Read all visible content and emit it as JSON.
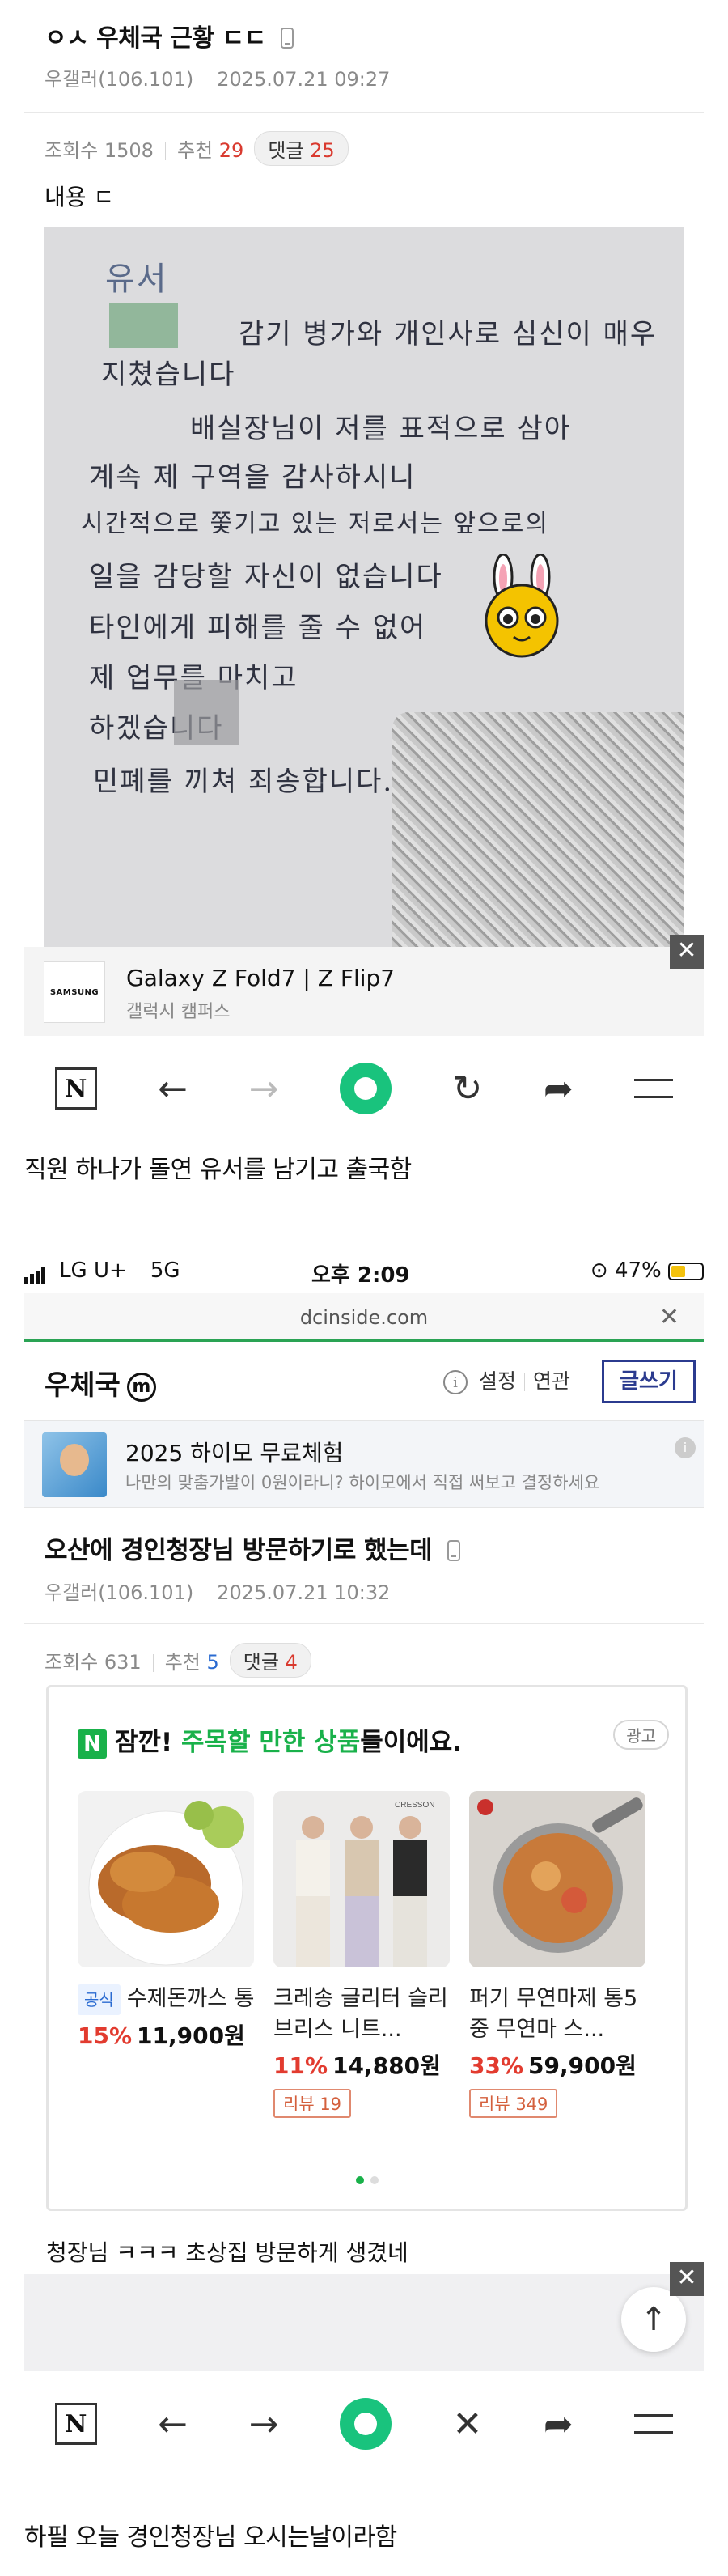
{
  "post1": {
    "title": "ㅇㅅ 우체국 근황 ㄷㄷ",
    "author": "우갤러(106.101)",
    "datetime": "2025.07.21 09:27",
    "views_label": "조회수 1508",
    "recommend_label": "추천",
    "recommend_count": "29",
    "comments_label": "댓글",
    "comments_count": "25",
    "body": "내용 ㄷ",
    "letter_lines": [
      "유서",
      "감기 병가와 개인사로 심신이 매우",
      "지쳤습니다",
      "배실장님이 저를 표적으로 삼아",
      "계속 제 구역을 감사하시니",
      "시간적으로 쫓기고 있는 저로서는 앞으로의",
      "일을 감당할 자신이 없습니다",
      "타인에게 피해를 줄 수 없어",
      "제 업무를 마치고",
      "하겠습니다",
      "민폐를 끼쳐 죄송합니다."
    ]
  },
  "ad1": {
    "logo": "SAMSUNG",
    "title": "Galaxy Z Fold7 | Z Flip7",
    "subtitle": "갤럭시 캠퍼스",
    "close": "✕"
  },
  "toolbar": {
    "n_label": "N",
    "back": "←",
    "forward": "→",
    "reload": "↻",
    "share": "➦",
    "close": "✕"
  },
  "caption1": "직원 하나가 돌연 유서를 남기고 출국함",
  "status_bar": {
    "carrier": "LG U+",
    "network": "5G",
    "time": "오후 2:09",
    "battery": "47%",
    "battery_level": 0.47
  },
  "url": "dcinside.com",
  "gallery": {
    "name": "우체국",
    "m_badge": "m",
    "info": "i",
    "settings": "설정",
    "related": "연관",
    "write": "글쓰기"
  },
  "banner": {
    "title": "2025 하이모 무료체험",
    "subtitle": "나만의 맞춤가발이 0원이라니? 하이모에서 직접 써보고 결정하세요"
  },
  "post2": {
    "title": "오산에 경인청장님 방문하기로 했는데",
    "author": "우갤러(106.101)",
    "datetime": "2025.07.21 10:32",
    "views_label": "조회수 631",
    "recommend_label": "추천",
    "recommend_count": "5",
    "comments_label": "댓글",
    "comments_count": "4",
    "body": "청장님 ㅋㅋㅋ 초상집 방문하게 생겼네"
  },
  "product_card": {
    "badge": "N",
    "headline_pre": "잠깐! ",
    "headline_highlight": "주목할 만한 상품",
    "headline_post": "들이에요.",
    "ad_tag": "광고",
    "products": [
      {
        "official": "공식",
        "name": "수제돈까스 통카스 경양식 ...",
        "discount": "15%",
        "price": "11,900원",
        "review": ""
      },
      {
        "official": "",
        "name": "크레송 글리터 슬리브리스 니트...",
        "discount": "11%",
        "price": "14,880원",
        "review": "리뷰 19",
        "brand_mark": "CRESSON"
      },
      {
        "official": "",
        "name": "퍼기 무연마제 통5중 무연마 스...",
        "discount": "33%",
        "price": "59,900원",
        "review": "리뷰 349"
      }
    ]
  },
  "scroll_top": "↑",
  "caption2": "하필 오늘 경인청장님 오시는날이라함"
}
